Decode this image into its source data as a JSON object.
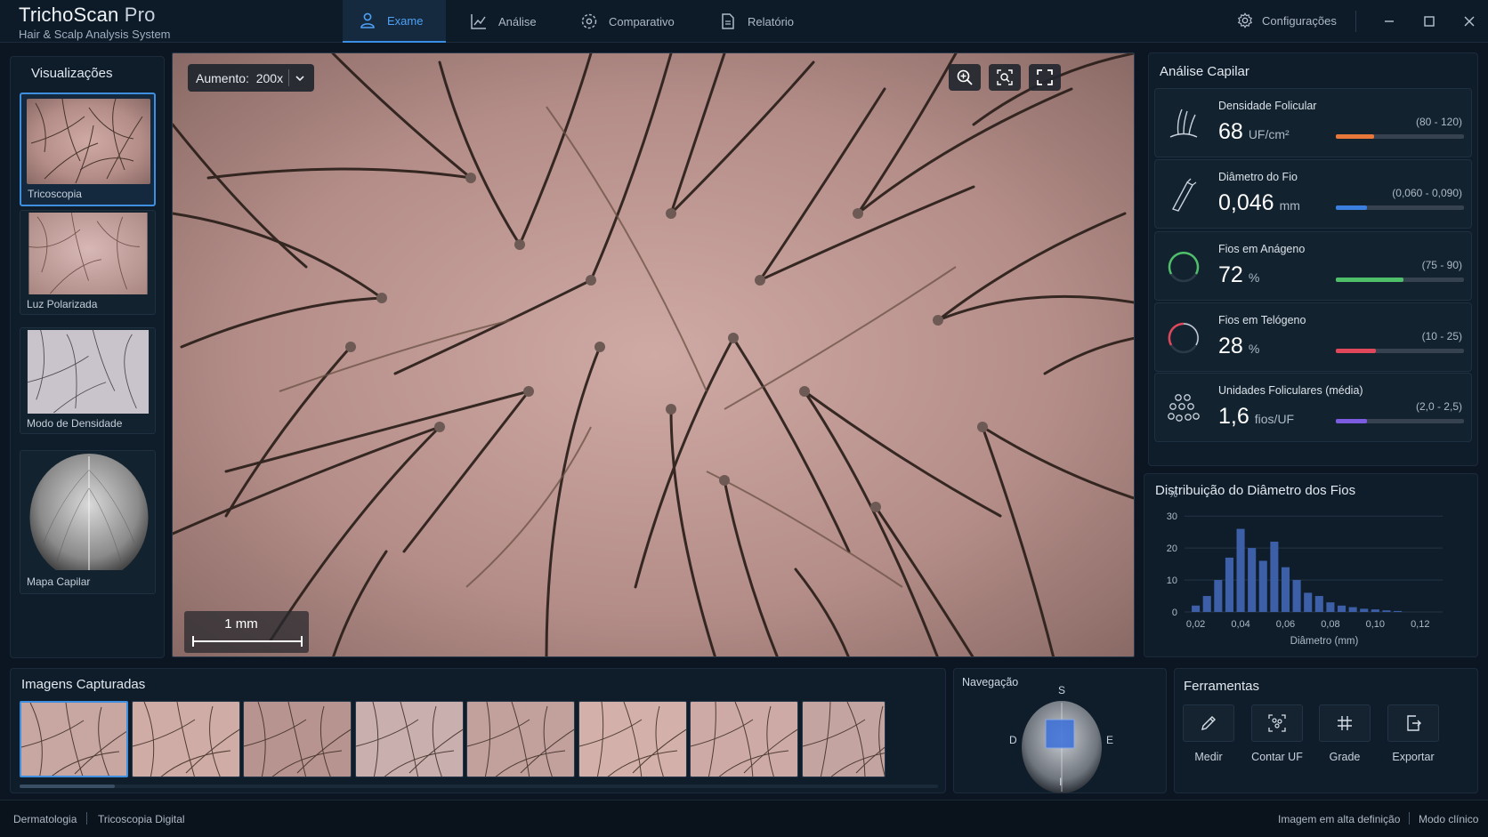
{
  "app": {
    "title": "TrichoScan",
    "title_suffix": "Pro",
    "subtitle": "Hair & Scalp Analysis System"
  },
  "tabs": [
    {
      "label": "Exame",
      "active": true,
      "icon": "user-icon"
    },
    {
      "label": "Análise",
      "active": false,
      "icon": "chart-icon"
    },
    {
      "label": "Comparativo",
      "active": false,
      "icon": "compare-icon"
    },
    {
      "label": "Relatório",
      "active": false,
      "icon": "document-icon"
    }
  ],
  "settings_label": "Configurações",
  "visualizations": {
    "title": "Visualizações",
    "items": [
      {
        "label": "Tricoscopia",
        "active": true
      },
      {
        "label": "Luz Polarizada",
        "active": false
      },
      {
        "label": "Modo de Densidade",
        "active": false
      },
      {
        "label": "Mapa Capilar",
        "active": false
      }
    ]
  },
  "viewer": {
    "zoom_label": "Aumento:",
    "zoom_value": "200x",
    "scale_label": "1 mm"
  },
  "analysis": {
    "title": "Análise Capilar",
    "metrics": [
      {
        "name": "Densidade Folicular",
        "value": "68",
        "unit": "UF/cm²",
        "range": "(80 - 120)",
        "level": 0.3,
        "color": "#e8773a",
        "icon": "follicle-icon"
      },
      {
        "name": "Diâmetro do Fio",
        "value": "0,046",
        "unit": "mm",
        "range": "(0,060 - 0,090)",
        "level": 0.24,
        "color": "#3b7fe0",
        "icon": "caliper-icon"
      },
      {
        "name": "Fios em Anágeno",
        "value": "72",
        "unit": "%",
        "range": "(75 - 90)",
        "level": 0.53,
        "color": "#4fbf6a",
        "icon": "anagen-gauge-icon"
      },
      {
        "name": "Fios em Telógeno",
        "value": "28",
        "unit": "%",
        "range": "(10 - 25)",
        "level": 0.31,
        "color": "#e0475a",
        "icon": "telogen-gauge-icon"
      },
      {
        "name": "Unidades Foliculares (média)",
        "value": "1,6",
        "unit": "fios/UF",
        "range": "(2,0 - 2,5)",
        "level": 0.24,
        "color": "#7b5be0",
        "icon": "follicular-units-icon"
      }
    ]
  },
  "histogram": {
    "title": "Distribuição do Diâmetro dos Fios"
  },
  "chart_data": {
    "type": "bar",
    "title": "Distribuição do Diâmetro dos Fios",
    "xlabel": "Diâmetro (mm)",
    "ylabel": "%",
    "x_ticks": [
      "0,02",
      "0,04",
      "0,06",
      "0,08",
      "0,10",
      "0,12"
    ],
    "y_ticks": [
      "0",
      "10",
      "20",
      "30"
    ],
    "xlim": [
      0.015,
      0.13
    ],
    "ylim": [
      0,
      32
    ],
    "x": [
      0.02,
      0.025,
      0.03,
      0.035,
      0.04,
      0.045,
      0.05,
      0.055,
      0.06,
      0.065,
      0.07,
      0.075,
      0.08,
      0.085,
      0.09,
      0.095,
      0.1,
      0.105,
      0.11
    ],
    "values": [
      2,
      5,
      10,
      17,
      26,
      20,
      16,
      22,
      14,
      10,
      6,
      5,
      3,
      2,
      1.5,
      1,
      0.8,
      0.5,
      0.3
    ],
    "grid": true,
    "color": "#3c5fa8"
  },
  "captured": {
    "title": "Imagens Capturadas",
    "count": 8,
    "active_index": 0
  },
  "navigation": {
    "title": "Navegação",
    "north": "S",
    "south": "I",
    "west": "D",
    "east": "E"
  },
  "tools": {
    "title": "Ferramentas",
    "items": [
      {
        "label": "Medir",
        "icon": "pencil-icon"
      },
      {
        "label": "Contar UF",
        "icon": "count-uf-icon"
      },
      {
        "label": "Grade",
        "icon": "grid-icon"
      },
      {
        "label": "Exportar",
        "icon": "export-icon"
      }
    ]
  },
  "statusbar": {
    "left1": "Dermatologia",
    "left2": "Tricoscopia Digital",
    "right1": "Imagem em alta definição",
    "right2": "Modo clínico"
  }
}
